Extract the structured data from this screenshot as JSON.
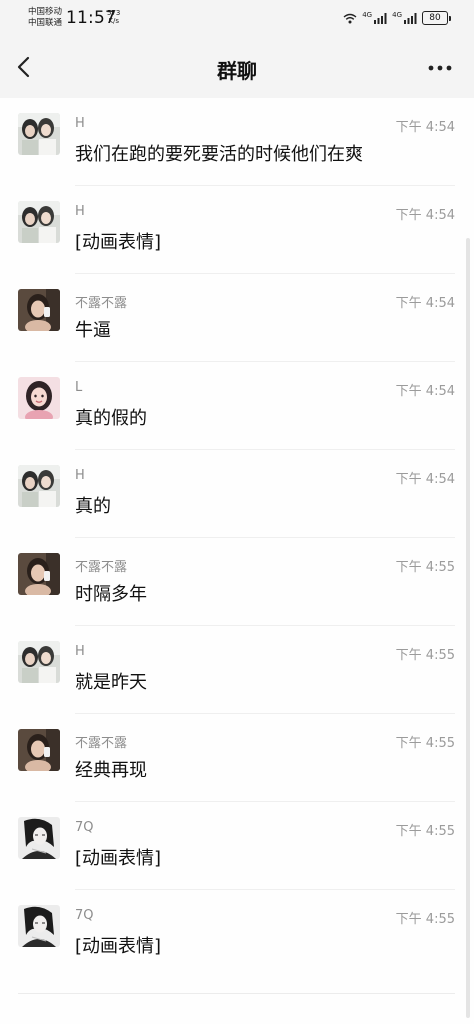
{
  "status_bar": {
    "carrier_1": "中国移动",
    "carrier_2": "中国联通",
    "time": "11:57",
    "net_speed_value": "573",
    "net_speed_unit": "K/s",
    "sim1_label": "4G",
    "sim2_label": "4G",
    "battery": "80"
  },
  "title_bar": {
    "title": "群聊"
  },
  "messages": [
    {
      "sender": "H",
      "time": "下午 4:54",
      "text": "我们在跑的要死要活的时候他们在爽",
      "avatar": "girls-photo-avatar"
    },
    {
      "sender": "H",
      "time": "下午 4:54",
      "text": "[动画表情]",
      "avatar": "girls-photo-avatar"
    },
    {
      "sender": "不露不露",
      "time": "下午 4:54",
      "text": "牛逼",
      "avatar": "selfie-avatar"
    },
    {
      "sender": "L",
      "time": "下午 4:54",
      "text": "真的假的",
      "avatar": "pink-portrait-avatar"
    },
    {
      "sender": "H",
      "time": "下午 4:54",
      "text": "真的",
      "avatar": "girls-photo-avatar"
    },
    {
      "sender": "不露不露",
      "time": "下午 4:55",
      "text": "时隔多年",
      "avatar": "selfie-avatar"
    },
    {
      "sender": "H",
      "time": "下午 4:55",
      "text": "就是昨天",
      "avatar": "girls-photo-avatar"
    },
    {
      "sender": "不露不露",
      "time": "下午 4:55",
      "text": "经典再现",
      "avatar": "selfie-avatar"
    },
    {
      "sender": "7Q",
      "time": "下午 4:55",
      "text": "[动画表情]",
      "avatar": "bw-sketch-avatar"
    },
    {
      "sender": "7Q",
      "time": "下午 4:55",
      "text": "[动画表情]",
      "avatar": "bw-sketch-avatar"
    }
  ]
}
